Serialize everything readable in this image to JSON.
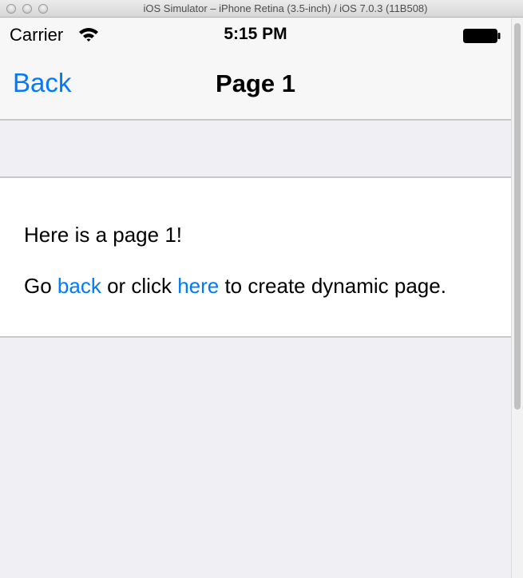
{
  "window": {
    "title": "iOS Simulator – iPhone Retina (3.5-inch) / iOS 7.0.3 (11B508)"
  },
  "status_bar": {
    "carrier": "Carrier",
    "time": "5:15 PM",
    "wifi_icon": "wifi-icon",
    "battery_icon": "battery-icon"
  },
  "nav_bar": {
    "back_label": "Back",
    "title": "Page 1"
  },
  "content": {
    "line1": "Here is a page 1!",
    "line2_prefix": "Go ",
    "line2_link1": "back",
    "line2_middle": " or click ",
    "line2_link2": "here",
    "line2_suffix": " to create dynamic page."
  },
  "colors": {
    "ios_blue": "#007aff",
    "group_background": "#efeff4",
    "separator": "#c8c7cc"
  }
}
